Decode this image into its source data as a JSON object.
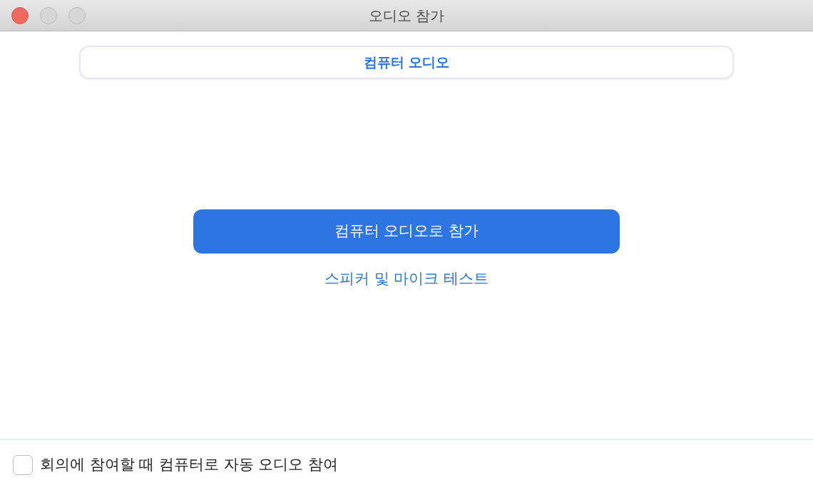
{
  "window": {
    "title": "오디오 참가"
  },
  "tabs": [
    {
      "label": "컴퓨터 오디오",
      "selected": true
    }
  ],
  "join_button": {
    "label": "컴퓨터 오디오로 참가"
  },
  "test_link": {
    "label": "스피커 및 마이크 테스트"
  },
  "auto_join": {
    "label": "회의에 참여할 때 컴퓨터로 자동 오디오 참여",
    "checked": false
  }
}
